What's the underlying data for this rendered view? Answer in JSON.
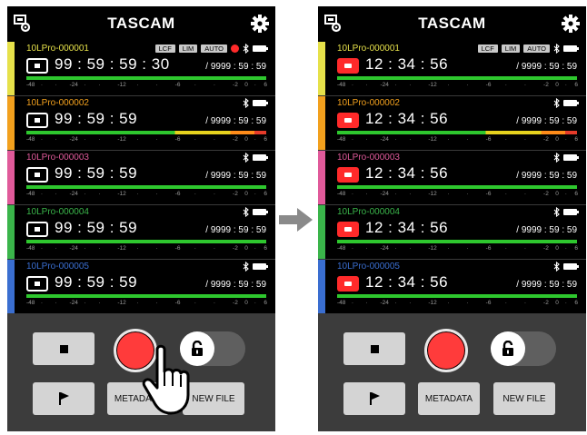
{
  "brand": "TASCAM",
  "scale_ticks": [
    "-48",
    "·",
    "·",
    "-24",
    "·",
    "·",
    "-12",
    "·",
    "·",
    "-6",
    "·",
    "·",
    "-2",
    "0",
    "·",
    "6"
  ],
  "colors": {
    "yellow": "#e6e14a",
    "orange": "#f2a01d",
    "pink": "#e05a9a",
    "green": "#3ab44a",
    "blue": "#3a6ed0",
    "record_red": "#ff3b3b"
  },
  "before": {
    "tracks": [
      {
        "name": "10LPro-000001",
        "color": "#e6e14a",
        "status": "stopped",
        "counter": "99 : 59 : 59 : 30",
        "remain": "/ 9999 : 59 : 59",
        "level": 1.0,
        "multi": false,
        "badges": [
          "LCF",
          "LIM",
          "AUTO"
        ],
        "rec_dot": true,
        "bluetooth": true
      },
      {
        "name": "10LPro-000002",
        "color": "#f2a01d",
        "status": "stopped",
        "counter": "99 : 59 : 59",
        "remain": "/ 9999 : 59 : 59",
        "level": 1.0,
        "multi": true,
        "badges": [],
        "rec_dot": false,
        "bluetooth": true
      },
      {
        "name": "10LPro-000003",
        "color": "#e05a9a",
        "status": "stopped",
        "counter": "99 : 59 : 59",
        "remain": "/ 9999 : 59 : 59",
        "level": 1.0,
        "multi": false,
        "badges": [],
        "rec_dot": false,
        "bluetooth": true
      },
      {
        "name": "10LPro-000004",
        "color": "#3ab44a",
        "status": "stopped",
        "counter": "99 : 59 : 59",
        "remain": "/ 9999 : 59 : 59",
        "level": 1.0,
        "multi": false,
        "badges": [],
        "rec_dot": false,
        "bluetooth": true
      },
      {
        "name": "10LPro-000005",
        "color": "#3a6ed0",
        "status": "stopped",
        "counter": "99 : 59 : 59",
        "remain": "/ 9999 : 59 : 59",
        "level": 1.0,
        "multi": false,
        "badges": [],
        "rec_dot": false,
        "bluetooth": true
      }
    ],
    "metadata_label": "METADATA",
    "newfile_label": "NEW FILE"
  },
  "after": {
    "tracks": [
      {
        "name": "10LPro-000001",
        "color": "#e6e14a",
        "status": "recording",
        "counter": "12 : 34 : 56",
        "remain": "/ 9999 : 59 : 59",
        "level": 1.0,
        "multi": false,
        "badges": [
          "LCF",
          "LIM",
          "AUTO"
        ],
        "rec_dot": false,
        "bluetooth": true
      },
      {
        "name": "10LPro-000002",
        "color": "#f2a01d",
        "status": "recording",
        "counter": "12 : 34 : 56",
        "remain": "/ 9999 : 59 : 59",
        "level": 1.0,
        "multi": true,
        "badges": [],
        "rec_dot": false,
        "bluetooth": true
      },
      {
        "name": "10LPro-000003",
        "color": "#e05a9a",
        "status": "recording",
        "counter": "12 : 34 : 56",
        "remain": "/ 9999 : 59 : 59",
        "level": 1.0,
        "multi": false,
        "badges": [],
        "rec_dot": false,
        "bluetooth": true
      },
      {
        "name": "10LPro-000004",
        "color": "#3ab44a",
        "status": "recording",
        "counter": "12 : 34 : 56",
        "remain": "/ 9999 : 59 : 59",
        "level": 1.0,
        "multi": false,
        "badges": [],
        "rec_dot": false,
        "bluetooth": true
      },
      {
        "name": "10LPro-000005",
        "color": "#3a6ed0",
        "status": "recording",
        "counter": "12 : 34 : 56",
        "remain": "/ 9999 : 59 : 59",
        "level": 1.0,
        "multi": false,
        "badges": [],
        "rec_dot": false,
        "bluetooth": true
      }
    ],
    "metadata_label": "METADATA",
    "newfile_label": "NEW FILE"
  }
}
